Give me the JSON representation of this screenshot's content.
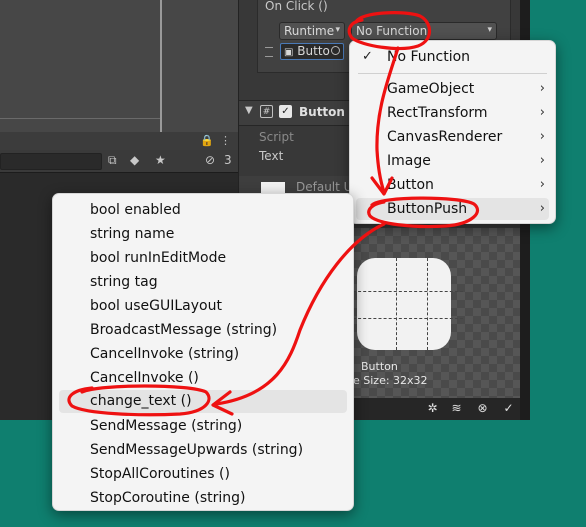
{
  "inspector": {
    "on_click_label": "On Click ()",
    "runtime_dropdown": "Runtime",
    "function_dropdown": "No Function",
    "object_field": "Butto",
    "component_name": "Button P",
    "script_label": "Script",
    "text_label": "Text",
    "default_label": "Default U"
  },
  "preview": {
    "sprite_name": "Button",
    "sprite_size": "e Size: 32x32"
  },
  "toolbar": {
    "hidden_count": "3"
  },
  "function_menu": {
    "items": [
      {
        "label": "No Function",
        "checked": true,
        "submenu": false
      },
      {
        "label": "GameObject",
        "submenu": true
      },
      {
        "label": "RectTransform",
        "submenu": true
      },
      {
        "label": "CanvasRenderer",
        "submenu": true
      },
      {
        "label": "Image",
        "submenu": true
      },
      {
        "label": "Button",
        "submenu": true
      },
      {
        "label": "ButtonPush",
        "submenu": true,
        "highlighted": true
      }
    ]
  },
  "submenu": {
    "items": [
      {
        "label": "bool enabled"
      },
      {
        "label": "string name"
      },
      {
        "label": "bool runInEditMode"
      },
      {
        "label": "string tag"
      },
      {
        "label": "bool useGUILayout"
      },
      {
        "label": "BroadcastMessage (string)"
      },
      {
        "label": "CancelInvoke (string)"
      },
      {
        "label": "CancelInvoke ()"
      },
      {
        "label": "change_text ()",
        "highlighted": true
      },
      {
        "label": "SendMessage (string)"
      },
      {
        "label": "SendMessageUpwards (string)"
      },
      {
        "label": "StopAllCoroutines ()"
      },
      {
        "label": "StopCoroutine (string)"
      }
    ]
  },
  "colors": {
    "desktop": "#0f7f6f",
    "annotation": "#ee1111",
    "menu_bg": "#f4f4f4",
    "highlight": "#e4e4e4"
  }
}
